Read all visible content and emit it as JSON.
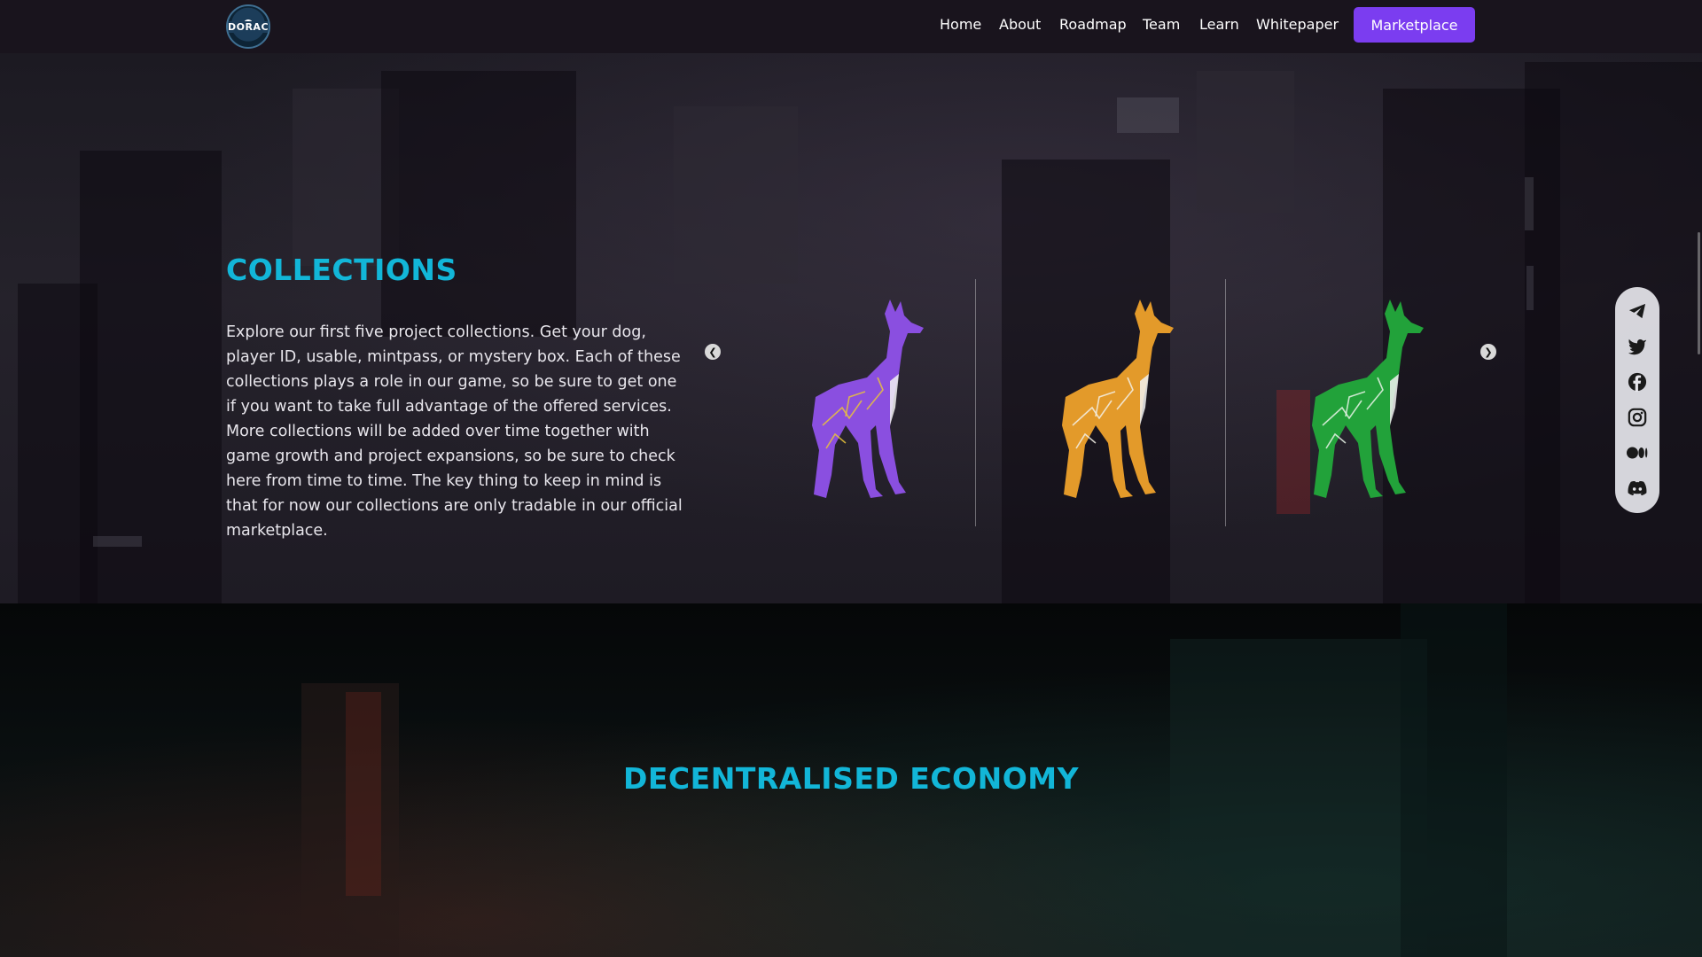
{
  "nav": {
    "logo_text": "DORAC",
    "links": [
      "Home",
      "About",
      "Roadmap",
      "Team",
      "Learn",
      "Whitepaper"
    ],
    "cta_label": "Marketplace"
  },
  "collections": {
    "title": "COLLECTIONS",
    "text": "Explore our first five project collections. Get your dog, player ID, usable, mintpass, or mystery box. Each of these collections plays a role in our game, so be sure to get one if you want to take full advantage of the offered services. More collections will be added over time together with game growth and project expansions, so be sure to check here from time to time. The key thing to keep in mind is that for now our collections are only tradable in our official marketplace.",
    "slides": [
      {
        "name": "purple-dog",
        "color": "#8a4fe0",
        "accent": "#e9c23b"
      },
      {
        "name": "orange-dog",
        "color": "#e39a2a",
        "accent": "#f3f0e6"
      },
      {
        "name": "green-dog",
        "color": "#22a23a",
        "accent": "#e8f3e8"
      }
    ],
    "prev_icon": "chevron-left-icon",
    "next_icon": "chevron-right-icon"
  },
  "social": [
    "telegram-icon",
    "twitter-icon",
    "facebook-icon",
    "instagram-icon",
    "medium-icon",
    "discord-icon"
  ],
  "economy": {
    "title": "DECENTRALISED ECONOMY"
  },
  "colors": {
    "accent": "#12b6d8",
    "cta": "#7b3df0",
    "nav_bg": "#19141d"
  }
}
